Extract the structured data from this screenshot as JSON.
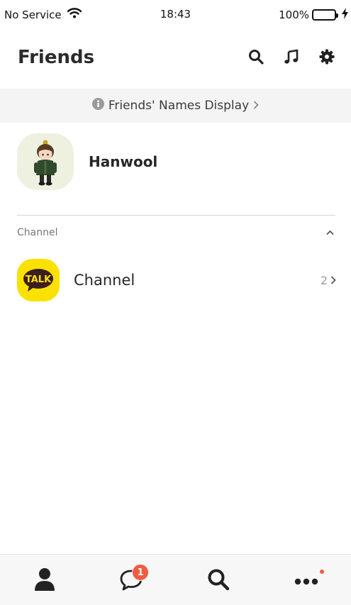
{
  "status_bar": {
    "carrier": "No Service",
    "time": "18:43",
    "battery": "100%"
  },
  "header": {
    "title": "Friends"
  },
  "notice": {
    "text": "Friends' Names Display"
  },
  "profile": {
    "name": "Hanwool"
  },
  "channel_section": {
    "header": "Channel",
    "item_label": "Channel",
    "item_count": "2",
    "talk_logo_text": "TALK"
  },
  "tabbar": {
    "chat_badge": "1"
  },
  "colors": {
    "talk_yellow": "#fae100",
    "badge_red": "#f15b40"
  }
}
